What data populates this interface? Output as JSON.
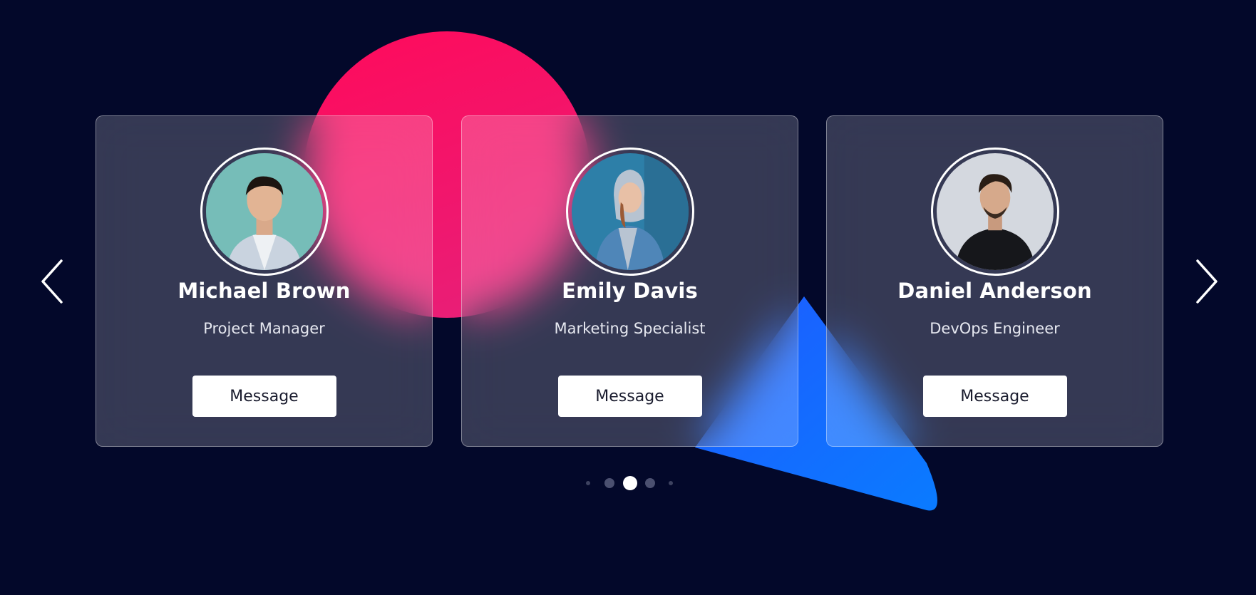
{
  "carousel": {
    "cards": [
      {
        "name": "Michael Brown",
        "role": "Project Manager",
        "button_label": "Message",
        "avatar": "person-avatar-teal-wall"
      },
      {
        "name": "Emily Davis",
        "role": "Marketing Specialist",
        "button_label": "Message",
        "avatar": "person-avatar-blue-wall"
      },
      {
        "name": "Daniel Anderson",
        "role": "DevOps Engineer",
        "button_label": "Message",
        "avatar": "person-avatar-grey-wall"
      }
    ],
    "prev_icon": "chevron-left-icon",
    "next_icon": "chevron-right-icon",
    "pagination": {
      "total": 5,
      "active_index": 2
    }
  },
  "colors": {
    "background": "#03082a",
    "circle_accent": "#ff0a5b",
    "triangle_accent": "#0a6bff",
    "card_button": "#ffffff"
  }
}
